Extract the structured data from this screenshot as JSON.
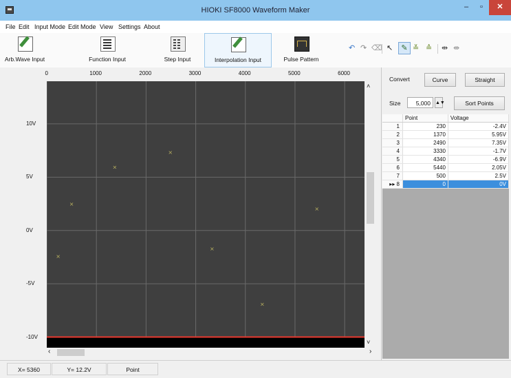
{
  "window": {
    "title": "HIOKI SF8000 Waveform Maker"
  },
  "menu": [
    "File",
    "Edit",
    "Input Mode",
    "Edit Mode",
    "View",
    "Settings",
    "About"
  ],
  "toolbar": {
    "buttons": [
      {
        "label": "Arb.Wave Input",
        "icon": "pencil-edit-icon"
      },
      {
        "label": "Function Input",
        "icon": "function-table-icon"
      },
      {
        "label": "Step Input",
        "icon": "step-table-icon"
      },
      {
        "label": "Interpolation Input",
        "icon": "pencil-edit-icon",
        "active": true
      },
      {
        "label": "Pulse Pattern",
        "icon": "pulse-pattern-icon"
      }
    ]
  },
  "chart_data": {
    "type": "scatter",
    "x_ticks": [
      "0",
      "1000",
      "2000",
      "3000",
      "4000",
      "5000",
      "6000"
    ],
    "y_ticks": [
      "10V",
      "5V",
      "0V",
      "-5V",
      "-10V"
    ],
    "xlim": [
      0,
      6400
    ],
    "ylim": [
      -11,
      14
    ],
    "points": [
      {
        "x": 230,
        "y": -2.4
      },
      {
        "x": 1370,
        "y": 5.95
      },
      {
        "x": 2490,
        "y": 7.35
      },
      {
        "x": 3330,
        "y": -1.7
      },
      {
        "x": 4340,
        "y": -6.9
      },
      {
        "x": 5440,
        "y": 2.05
      },
      {
        "x": 500,
        "y": 2.5
      }
    ],
    "background": "#3f3f3f",
    "grid": true,
    "marker_color": "#b8b060",
    "baseline": {
      "y": -10,
      "color": "#e8392f"
    }
  },
  "panel": {
    "convert_label": "Convert",
    "curve_button": "Curve",
    "straight_button": "Straight",
    "size_label": "Size",
    "size_value": "5,000",
    "sort_button": "Sort Points",
    "table": {
      "headers": [
        "Point",
        "Voltage"
      ],
      "rows": [
        {
          "index": "1",
          "point": "230",
          "voltage": "-2.4V"
        },
        {
          "index": "2",
          "point": "1370",
          "voltage": "5.95V"
        },
        {
          "index": "3",
          "point": "2490",
          "voltage": "7.35V"
        },
        {
          "index": "4",
          "point": "3330",
          "voltage": "-1.7V"
        },
        {
          "index": "5",
          "point": "4340",
          "voltage": "-6.9V"
        },
        {
          "index": "6",
          "point": "5440",
          "voltage": "2.05V"
        },
        {
          "index": "7",
          "point": "500",
          "voltage": "2.5V"
        },
        {
          "index": "8",
          "point": "0",
          "voltage": "0V",
          "selected": true
        }
      ]
    }
  },
  "status": {
    "x": "X= 5360",
    "y": "Y= 12.2V",
    "mode": "Point"
  }
}
